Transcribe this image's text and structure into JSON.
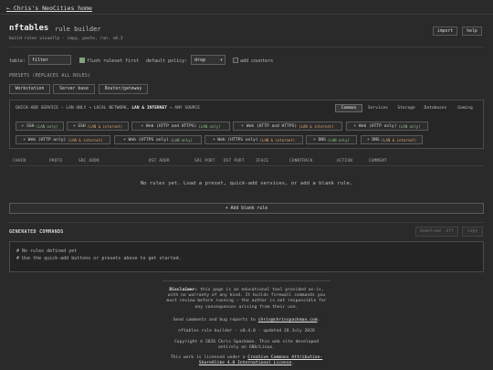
{
  "header": {
    "home_link": "← Chris's NeoCities home",
    "title": "nftables",
    "subtitle": "rule builder",
    "tagline": "build rules visually · copy, paste, run.  v0.3",
    "import_label": "import",
    "help_label": "help"
  },
  "settings": {
    "table_label": "table:",
    "table_value": "filter",
    "flush_label": "flush ruleset first",
    "flush_checked": true,
    "policy_label": "default policy:",
    "policy_value": "drop",
    "counters_label": "add counters",
    "counters_checked": false
  },
  "presets": {
    "header": "PRESETS (REPLACES ALL RULES)",
    "items": [
      "Workstation",
      "Server base",
      "Router/gateway"
    ]
  },
  "quick_add": {
    "header_prefix": "QUICK-ADD SERVICE — LAN ONLY → LOCAL NETWORK,",
    "header_bold": "LAN & INTERNET",
    "header_suffix": "→ ANY SOURCE",
    "tabs": [
      "Common",
      "Services",
      "Storage",
      "Databases",
      "Gaming"
    ],
    "active_tab": "Common",
    "services": [
      {
        "label": "+ SSH",
        "tag": "(LAN only)",
        "kind": "lan"
      },
      {
        "label": "+ SSH",
        "tag": "(LAN & internet)",
        "kind": "inet"
      },
      {
        "label": "+ Web (HTTP and HTTPS)",
        "tag": "(LAN only)",
        "kind": "lan"
      },
      {
        "label": "+ Web (HTTP and HTTPS)",
        "tag": "(LAN & internet)",
        "kind": "inet"
      },
      {
        "label": "+ Web (HTTP only)",
        "tag": "(LAN only)",
        "kind": "lan"
      },
      {
        "label": "+ Web (HTTP only)",
        "tag": "(LAN & internet)",
        "kind": "inet"
      },
      {
        "label": "+ Web (HTTPS only)",
        "tag": "(LAN only)",
        "kind": "lan"
      },
      {
        "label": "+ Web (HTTPS only)",
        "tag": "(LAN & internet)",
        "kind": "inet"
      },
      {
        "label": "+ DNS",
        "tag": "(LAN only)",
        "kind": "lan"
      },
      {
        "label": "+ DNS",
        "tag": "(LAN & internet)",
        "kind": "inet"
      }
    ]
  },
  "rules_table": {
    "columns": [
      "CHAIN",
      "PROTO",
      "SRC ADDR",
      "DST ADDR",
      "SRC PORT",
      "DST PORT",
      "IFACE",
      "CONNTRACK",
      "ACTION",
      "COMMENT"
    ],
    "empty_message": "No rules yet. Load a preset, quick-add services, or add a blank rule.",
    "add_blank_label": "+ Add blank rule"
  },
  "generated": {
    "header": "GENERATED COMMANDS",
    "download_label": "download .nft",
    "copy_label": "copy",
    "lines": [
      "# No rules defined yet",
      "# Use the quick-add buttons or presets above to get started."
    ]
  },
  "footer": {
    "disclaimer_bold": "Disclaimer:",
    "disclaimer_line1": "this page is an educational tool provided as-is,",
    "disclaimer_line2": "with no warranty of any kind. It builds firewall commands you",
    "disclaimer_line3": "must review before running — the author is not responsible for",
    "disclaimer_line4": "any consequences arising from their use.",
    "contact_prefix": "Send comments and bug reports to",
    "contact_email": "chris@chrisspackman.com",
    "version_line": "nftables rule builder · v0.4.0 · updated 28 July 2026",
    "copyright_line1": "Copyright © 2026 Chris Spackman. This web site developed",
    "copyright_line2": "entirely on GNU/Linux.",
    "license_prefix": "This work is licensed under a",
    "license_link1": "Creative Commons Attribution-",
    "license_link2": "ShareAlike 4.0 International License",
    "license_suffix": "."
  }
}
